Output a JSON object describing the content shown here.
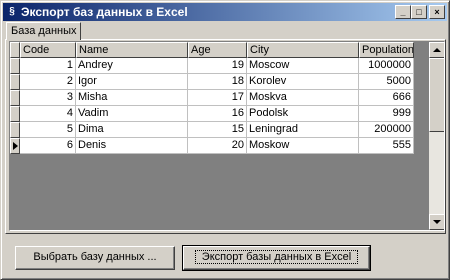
{
  "window": {
    "title": "Экспорт баз данных в Excel",
    "controls": {
      "minimize": "_",
      "maximize": "□",
      "close": "×"
    }
  },
  "tabs": [
    {
      "label": "База данных"
    }
  ],
  "table": {
    "columns": [
      "Code",
      "Name",
      "Age",
      "City",
      "Population"
    ],
    "rows": [
      {
        "code": "1",
        "name": "Andrey",
        "age": "19",
        "city": "Moscow",
        "population": "1000000"
      },
      {
        "code": "2",
        "name": "Igor",
        "age": "18",
        "city": "Korolev",
        "population": "5000"
      },
      {
        "code": "3",
        "name": "Misha",
        "age": "17",
        "city": "Moskva",
        "population": "666"
      },
      {
        "code": "4",
        "name": "Vadim",
        "age": "16",
        "city": "Podolsk",
        "population": "999"
      },
      {
        "code": "5",
        "name": "Dima",
        "age": "15",
        "city": "Leningrad",
        "population": "200000"
      },
      {
        "code": "6",
        "name": "Denis",
        "age": "20",
        "city": "Moskow",
        "population": "555"
      }
    ],
    "current_row": 6
  },
  "buttons": {
    "select_db": "Выбрать базу данных ...",
    "export": "Экспорт базы данных в Excel"
  },
  "colors": {
    "titlebar_start": "#0a246a",
    "titlebar_end": "#a6caf0",
    "face": "#d4d0c8",
    "grid_background": "#808080"
  },
  "icons": {
    "app": "app-icon",
    "row_indicator": "row-pointer-icon",
    "scroll_up": "scroll-up-arrow-icon",
    "scroll_down": "scroll-down-arrow-icon"
  }
}
